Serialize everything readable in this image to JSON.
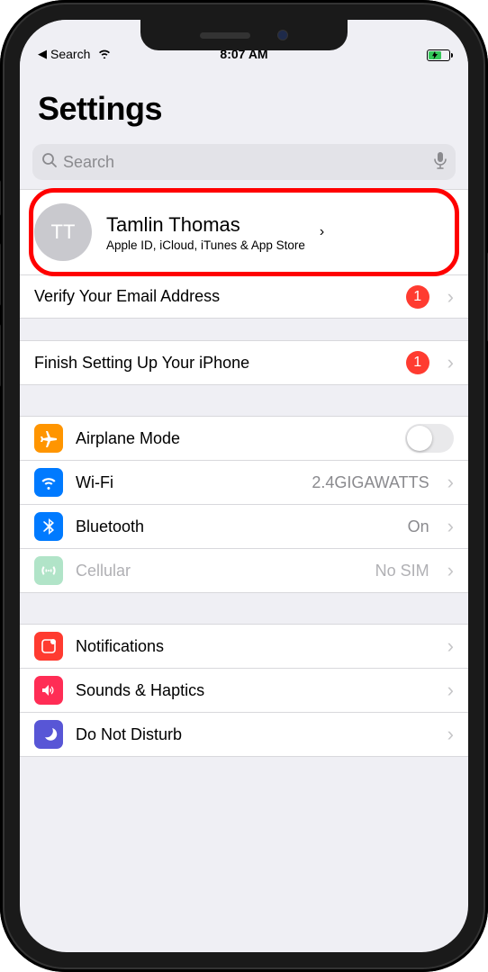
{
  "status": {
    "back_label": "Search",
    "time": "8:07 AM"
  },
  "page_title": "Settings",
  "search": {
    "placeholder": "Search"
  },
  "appleid": {
    "initials": "TT",
    "name": "Tamlin Thomas",
    "subtitle": "Apple ID, iCloud, iTunes & App Store"
  },
  "rows": {
    "verify": {
      "label": "Verify Your Email Address",
      "badge": "1"
    },
    "finish": {
      "label": "Finish Setting Up Your iPhone",
      "badge": "1"
    },
    "airplane": {
      "label": "Airplane Mode"
    },
    "wifi": {
      "label": "Wi-Fi",
      "detail": "2.4GIGAWATTS"
    },
    "bluetooth": {
      "label": "Bluetooth",
      "detail": "On"
    },
    "cellular": {
      "label": "Cellular",
      "detail": "No SIM"
    },
    "notifications": {
      "label": "Notifications"
    },
    "sounds": {
      "label": "Sounds & Haptics"
    },
    "dnd": {
      "label": "Do Not Disturb"
    }
  }
}
